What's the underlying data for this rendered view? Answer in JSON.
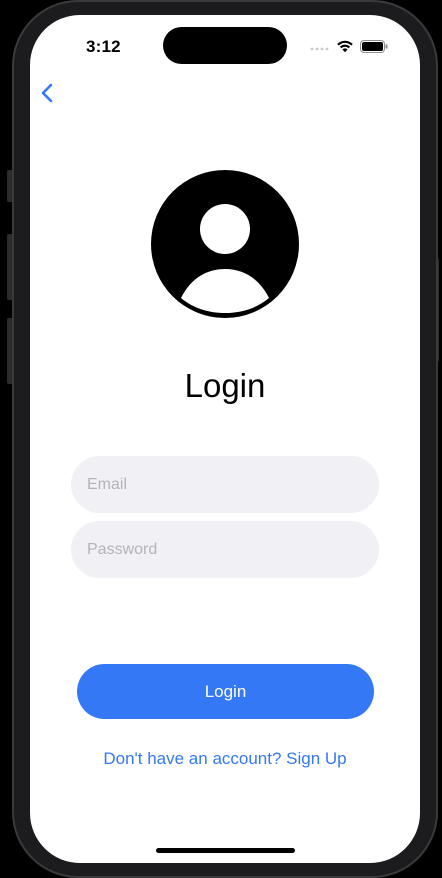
{
  "status_bar": {
    "time": "3:12"
  },
  "nav": {
    "back_icon": "chevron-left-icon"
  },
  "avatar": {
    "icon": "person-circle-icon"
  },
  "login": {
    "title": "Login",
    "email_placeholder": "Email",
    "email_value": "",
    "password_placeholder": "Password",
    "password_value": "",
    "login_button_label": "Login",
    "signup_link_label": "Don't have an account? Sign Up"
  },
  "colors": {
    "accent": "#3478f6",
    "field_background": "#f0f0f5",
    "placeholder": "#b3b3b8"
  }
}
